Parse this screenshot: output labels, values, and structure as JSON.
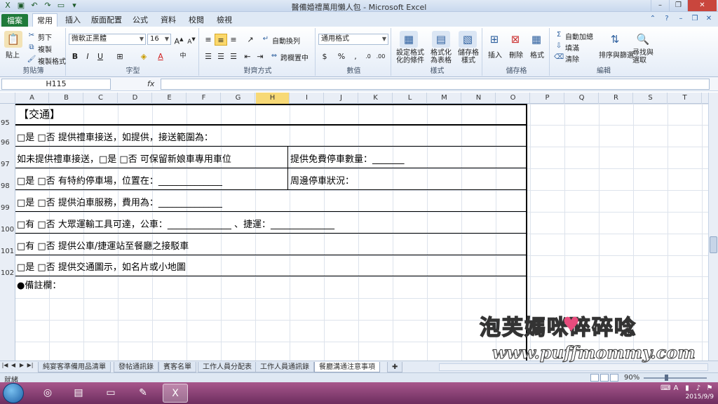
{
  "window": {
    "title": "醫備婚禮萬用懶人包 - Microsoft Excel"
  },
  "ribbon_tabs": [
    "檔案",
    "常用",
    "插入",
    "版面配置",
    "公式",
    "資料",
    "校閱",
    "檢視"
  ],
  "clipboard": {
    "paste": "貼上",
    "cut": "剪下",
    "copy": "複製",
    "format_painter": "複製格式",
    "label": "剪貼簿"
  },
  "font": {
    "name": "微軟正黑體",
    "size": "16",
    "label": "字型"
  },
  "alignment": {
    "wrap_text": "自動換列",
    "merge_center": "跨欄置中",
    "label": "對齊方式"
  },
  "number": {
    "format": "通用格式",
    "label": "數值"
  },
  "styles": {
    "conditional": "設定格式化的條件",
    "format_table": "格式化為表格",
    "cell_styles": "儲存格樣式",
    "label": "樣式"
  },
  "cells": {
    "insert": "插入",
    "delete": "刪除",
    "format": "格式",
    "label": "儲存格"
  },
  "editing": {
    "autosum": "自動加總",
    "fill": "填滿",
    "clear": "清除",
    "sort_filter": "排序與篩選",
    "find_select": "尋找與選取",
    "label": "編輯"
  },
  "formula_bar": {
    "name_box": "H115",
    "fx": "fx",
    "value": ""
  },
  "columns": [
    "A",
    "B",
    "C",
    "D",
    "E",
    "F",
    "G",
    "H",
    "I",
    "J",
    "K",
    "L",
    "M",
    "N",
    "O",
    "P",
    "Q",
    "R",
    "S",
    "T"
  ],
  "selected_column": "H",
  "rows": [
    "95",
    "96",
    "97",
    "98",
    "99",
    "100",
    "101",
    "102"
  ],
  "sheet": {
    "header": "【交通】",
    "r96": "□是 □否 提供禮車接送，如提供，接送範圍為：",
    "r97_left": "如未提供禮車接送，□是 □否 可保留新娘車專用車位",
    "r97_right": "提供免費停車數量：_______",
    "r98_left": "□是 □否 有特約停車場，位置在：______________",
    "r98_right": "周邊停車狀況：",
    "r99": "□是 □否 提供泊車服務，費用為：______________",
    "r100": "□有 □否 大眾運輸工具可達，公車：______________ 、捷運：______________",
    "r101": "□有 □否 提供公車/捷運站至餐廳之接駁車",
    "r102": "□是 □否 提供交通圖示，如名片或小地圖",
    "notes": "●備註欄："
  },
  "sheet_tabs": [
    "純宴客準備用品清單",
    "發帖通訊錄",
    "賓客名單",
    "工作人員分配表",
    "工作人員通訊錄",
    "餐廳溝通注意事項"
  ],
  "active_sheet": "餐廳溝通注意事項",
  "status": {
    "ready": "就緒",
    "zoom": "90%"
  },
  "taskbar": {
    "date": "2015/9/9"
  },
  "watermark": {
    "title": "泡芙媽咪碎碎唸",
    "url": "www.puffmommy.com"
  }
}
